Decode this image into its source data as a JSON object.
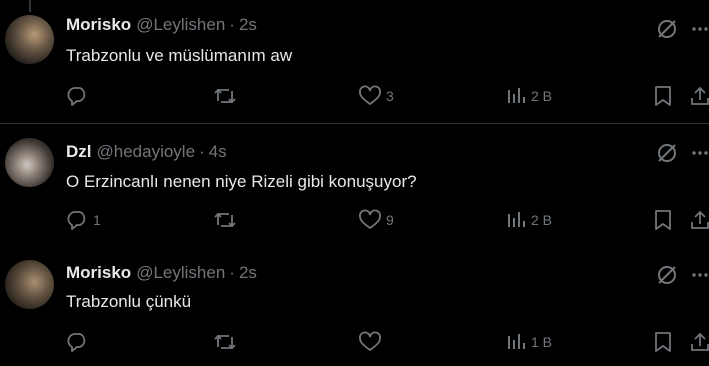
{
  "tweets": [
    {
      "name": "Morisko",
      "handle": "@Leylishen",
      "separator": "·",
      "time": "2s",
      "text": "Trabzonlu ve müslümanım aw",
      "replies": "",
      "retweets": "",
      "likes": "3",
      "views": "2 B"
    },
    {
      "name": "Dzl",
      "handle": "@hedayioyle",
      "separator": "·",
      "time": "4s",
      "text": "O Erzincanlı nenen niye Rizeli gibi konuşuyor?",
      "replies": "1",
      "retweets": "",
      "likes": "9",
      "views": "2 B"
    },
    {
      "name": "Morisko",
      "handle": "@Leylishen",
      "separator": "·",
      "time": "2s",
      "text": "Trabzonlu çünkü",
      "replies": "",
      "retweets": "",
      "likes": "",
      "views": "1 B"
    }
  ],
  "colors": {
    "background": "#000000",
    "text_primary": "#e7e9ea",
    "text_secondary": "#71767b",
    "divider": "#2f3336"
  },
  "icons": [
    "grok-icon",
    "more-icon",
    "reply-icon",
    "retweet-icon",
    "like-icon",
    "views-icon",
    "bookmark-icon",
    "share-icon"
  ]
}
